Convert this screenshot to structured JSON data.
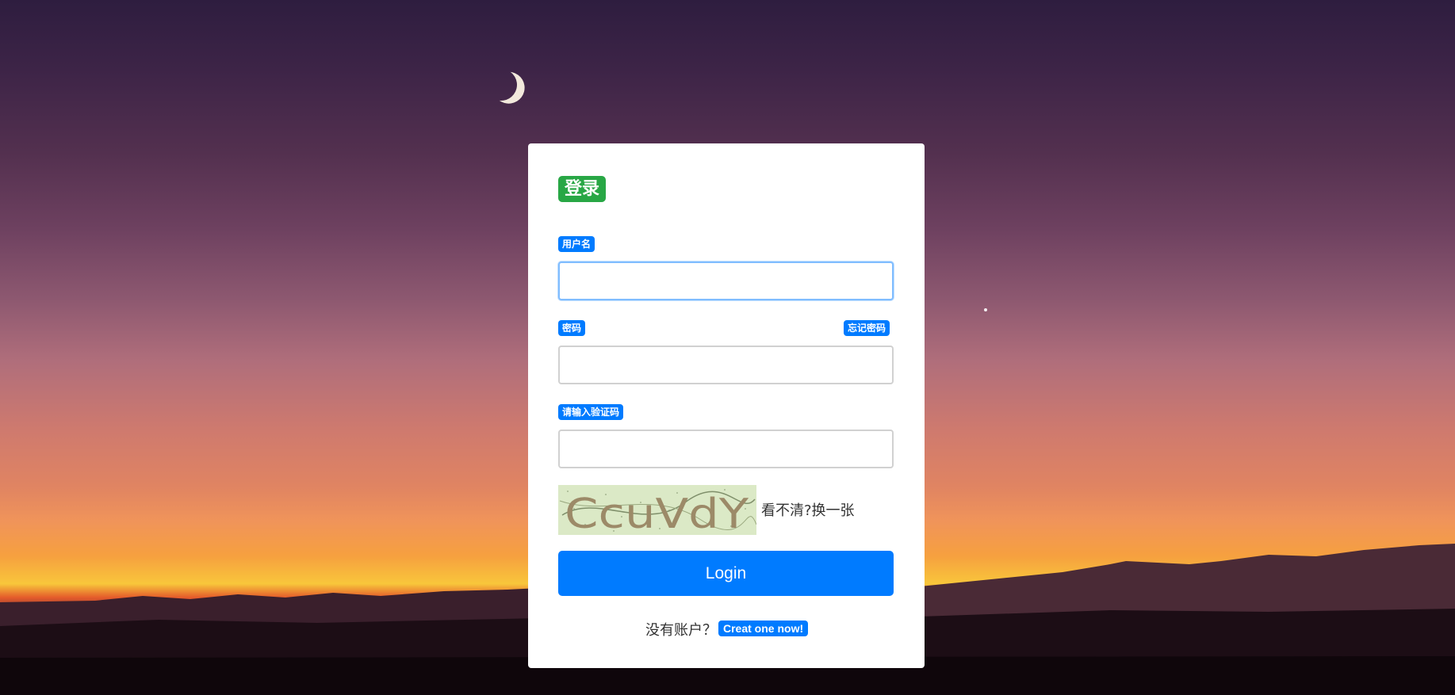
{
  "form": {
    "title": "登录",
    "username_label": "用户名",
    "username_value": "",
    "password_label": "密码",
    "forgot_password": "忘记密码",
    "password_value": "",
    "captcha_label": "请输入验证码",
    "captcha_value": "",
    "captcha_text": "CcuVdY",
    "refresh_captcha": "看不清?换一张",
    "login_button": "Login",
    "no_account": "没有账户？",
    "create_account": "Creat one now!"
  },
  "colors": {
    "title_badge": "#28a745",
    "label_badge": "#007bff",
    "login_button": "#007bff",
    "focus_border": "#80bdff"
  }
}
